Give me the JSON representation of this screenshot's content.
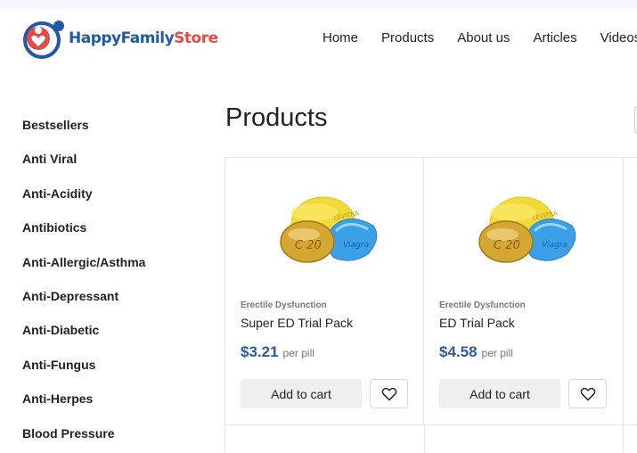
{
  "header": {
    "logo": {
      "part1": "HappyFamily",
      "part2": "Store"
    },
    "nav": [
      "Home",
      "Products",
      "About us",
      "Articles",
      "Videos"
    ]
  },
  "sidebar": {
    "items": [
      "Bestsellers",
      "Anti Viral",
      "Anti-Acidity",
      "Antibiotics",
      "Anti-Allergic/Asthma",
      "Anti-Depressant",
      "Anti-Diabetic",
      "Anti-Fungus",
      "Anti-Herpes",
      "Blood Pressure"
    ]
  },
  "main": {
    "title": "Products",
    "products": [
      {
        "category": "Erectile Dysfunction",
        "name": "Super ED Trial Pack",
        "price": "$3.21",
        "unit": "per pill",
        "cart_label": "Add to cart"
      },
      {
        "category": "Erectile Dysfunction",
        "name": "ED Trial Pack",
        "price": "$4.58",
        "unit": "per pill",
        "cart_label": "Add to cart"
      }
    ]
  },
  "colors": {
    "brand_blue": "#1f5aa6",
    "brand_red": "#e54b4b",
    "price_blue": "#2d5b9b"
  },
  "icons": {
    "favorite": "heart-outline-icon"
  }
}
